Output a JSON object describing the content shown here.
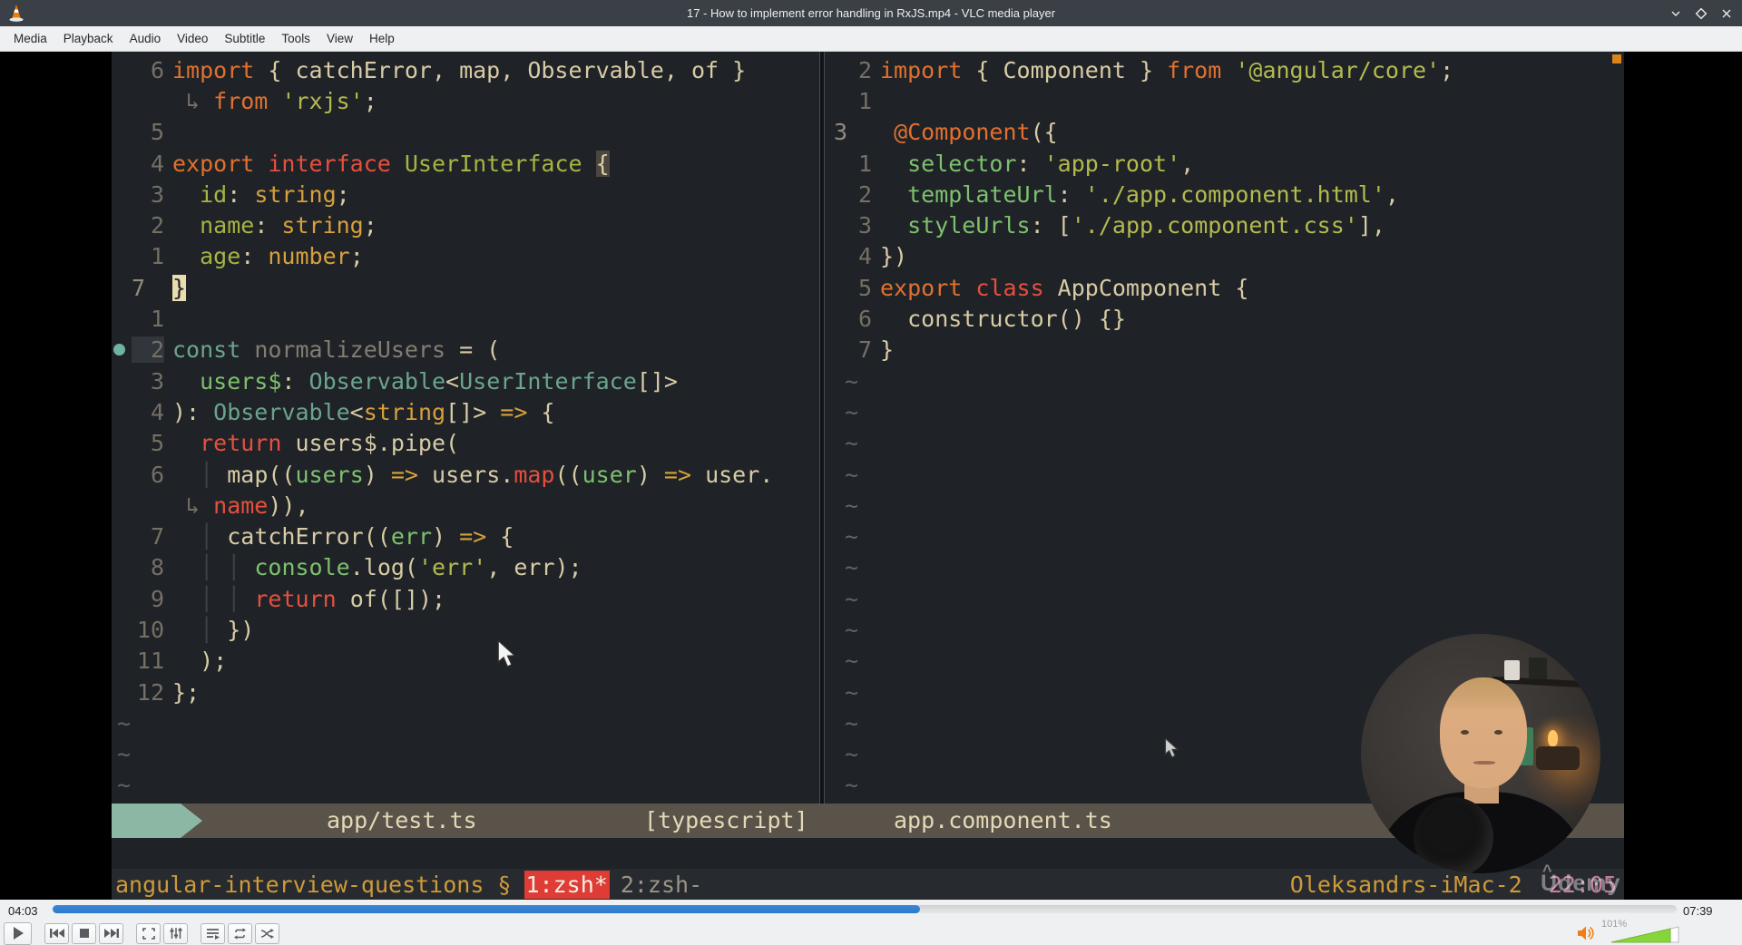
{
  "window": {
    "title": "17 - How to implement error handling in RxJS.mp4 - VLC media player",
    "menu": [
      "Media",
      "Playback",
      "Audio",
      "Video",
      "Subtitle",
      "Tools",
      "View",
      "Help"
    ]
  },
  "colors": {
    "editor_bg": "#1f2327",
    "statusline_bg": "#59534a",
    "statusline_accent": "#8cb7a5",
    "tmux_bg": "#272b30",
    "tmux_active_window_bg": "#de3c35",
    "seek_fill": "#3b87d8",
    "volume_fill": "#86d53b",
    "syntax_orange": "#e1702e",
    "syntax_red": "#e64f3e",
    "syntax_yellow": "#d8a03c",
    "syntax_lime": "#a7b343",
    "syntax_teal": "#6ba48d",
    "syntax_green": "#7dc16e"
  },
  "editor": {
    "left_pane": {
      "status_file": "app/test.ts",
      "status_type": "[typescript]",
      "tildes": 3,
      "rows": [
        {
          "n": "6",
          "s": [
            [
              "import ",
              "o"
            ],
            [
              "{ catchError, map, Observable, of }",
              "fg"
            ]
          ]
        },
        {
          "n": "",
          "s": [
            [
              " ↳ ",
              "wrap"
            ],
            [
              "from ",
              "o"
            ],
            [
              "'rxjs'",
              "str"
            ],
            [
              ";",
              "fg"
            ]
          ]
        },
        {
          "n": "5",
          "s": []
        },
        {
          "n": "4",
          "s": [
            [
              "export ",
              "o"
            ],
            [
              "interface ",
              "r"
            ],
            [
              "UserInterface ",
              "lime"
            ],
            [
              "{",
              "mp"
            ]
          ]
        },
        {
          "n": "3",
          "s": [
            [
              "  id",
              "lime"
            ],
            [
              ": ",
              "fg"
            ],
            [
              "string",
              "y"
            ],
            [
              ";",
              "fg"
            ]
          ]
        },
        {
          "n": "2",
          "s": [
            [
              "  name",
              "lime"
            ],
            [
              ": ",
              "fg"
            ],
            [
              "string",
              "y"
            ],
            [
              ";",
              "fg"
            ]
          ]
        },
        {
          "n": "1",
          "s": [
            [
              "  age",
              "lime"
            ],
            [
              ": ",
              "fg"
            ],
            [
              "number",
              "y"
            ],
            [
              ";",
              "fg"
            ]
          ]
        },
        {
          "n": "7",
          "cur": true,
          "s": [
            [
              "}",
              "cursor"
            ]
          ]
        },
        {
          "n": "1",
          "s": []
        },
        {
          "n": "2",
          "sign": true,
          "numhl": true,
          "s": [
            [
              "const ",
              "teal"
            ],
            [
              "normalizeUsers ",
              "dim"
            ],
            [
              "= (",
              "fg"
            ]
          ]
        },
        {
          "n": "3",
          "s": [
            [
              "  users$",
              "green"
            ],
            [
              ": ",
              "fg"
            ],
            [
              "Observable",
              "teal"
            ],
            [
              "<",
              "fg"
            ],
            [
              "UserInterface",
              "teal"
            ],
            [
              "[]>",
              "fg"
            ]
          ]
        },
        {
          "n": "4",
          "s": [
            [
              "): ",
              "fg"
            ],
            [
              "Observable",
              "teal"
            ],
            [
              "<",
              "fg"
            ],
            [
              "string",
              "y"
            ],
            [
              "[]> ",
              "fg"
            ],
            [
              "=> ",
              "y"
            ],
            [
              "{",
              "fg"
            ]
          ]
        },
        {
          "n": "5",
          "s": [
            [
              "  return ",
              "r"
            ],
            [
              "users$.pipe(",
              "fg"
            ]
          ]
        },
        {
          "n": "6",
          "s": [
            [
              "  ",
              "fg"
            ],
            [
              "│",
              "guide"
            ],
            [
              " map((",
              "fg"
            ],
            [
              "users",
              "green"
            ],
            [
              ") ",
              "fg"
            ],
            [
              "=> ",
              "y"
            ],
            [
              "users.",
              "fg"
            ],
            [
              "map",
              "r"
            ],
            [
              "((",
              "fg"
            ],
            [
              "user",
              "green"
            ],
            [
              ") ",
              "fg"
            ],
            [
              "=> ",
              "y"
            ],
            [
              "user.",
              "fg"
            ]
          ]
        },
        {
          "n": "",
          "s": [
            [
              " ↳ ",
              "wrap"
            ],
            [
              "name",
              "r"
            ],
            [
              ")),",
              "fg"
            ]
          ]
        },
        {
          "n": "7",
          "s": [
            [
              "  ",
              "fg"
            ],
            [
              "│",
              "guide"
            ],
            [
              " catchError((",
              "fg"
            ],
            [
              "err",
              "green"
            ],
            [
              ") ",
              "fg"
            ],
            [
              "=> ",
              "y"
            ],
            [
              "{",
              "fg"
            ]
          ]
        },
        {
          "n": "8",
          "s": [
            [
              "  ",
              "fg"
            ],
            [
              "│",
              "guide"
            ],
            [
              " ",
              "fg"
            ],
            [
              "│",
              "guide"
            ],
            [
              " console",
              "green"
            ],
            [
              ".log(",
              "fg"
            ],
            [
              "'err'",
              "str"
            ],
            [
              ", err);",
              "fg"
            ]
          ]
        },
        {
          "n": "9",
          "s": [
            [
              "  ",
              "fg"
            ],
            [
              "│",
              "guide"
            ],
            [
              " ",
              "fg"
            ],
            [
              "│",
              "guide"
            ],
            [
              " ",
              "fg"
            ],
            [
              "return ",
              "r"
            ],
            [
              "of([]);",
              "fg"
            ]
          ]
        },
        {
          "n": "10",
          "s": [
            [
              "  ",
              "fg"
            ],
            [
              "│",
              "guide"
            ],
            [
              " })",
              "fg"
            ]
          ]
        },
        {
          "n": "11",
          "s": [
            [
              "  );",
              "fg"
            ]
          ]
        },
        {
          "n": "12",
          "s": [
            [
              "};",
              "fg"
            ]
          ]
        }
      ]
    },
    "right_pane": {
      "status_file": "app.component.ts",
      "tildes": 14,
      "rows": [
        {
          "n": "2",
          "s": [
            [
              "import ",
              "o"
            ],
            [
              "{ Component } ",
              "fg"
            ],
            [
              "from ",
              "o"
            ],
            [
              "'@angular/core'",
              "str"
            ],
            [
              ";",
              "fg"
            ]
          ]
        },
        {
          "n": "1",
          "s": []
        },
        {
          "n": "3",
          "cur": true,
          "s": [
            [
              " ",
              "fg"
            ],
            [
              "@Component",
              "o"
            ],
            [
              "({",
              "fg"
            ]
          ]
        },
        {
          "n": "1",
          "s": [
            [
              "  selector",
              "green"
            ],
            [
              ": ",
              "fg"
            ],
            [
              "'app-root'",
              "str"
            ],
            [
              ",",
              "fg"
            ]
          ]
        },
        {
          "n": "2",
          "s": [
            [
              "  templateUrl",
              "green"
            ],
            [
              ": ",
              "fg"
            ],
            [
              "'./app.component.html'",
              "str"
            ],
            [
              ",",
              "fg"
            ]
          ]
        },
        {
          "n": "3",
          "s": [
            [
              "  styleUrls",
              "green"
            ],
            [
              ": [",
              "fg"
            ],
            [
              "'./app.component.css'",
              "str"
            ],
            [
              "],",
              "fg"
            ]
          ]
        },
        {
          "n": "4",
          "s": [
            [
              "})",
              "fg"
            ]
          ]
        },
        {
          "n": "5",
          "s": [
            [
              "export ",
              "o"
            ],
            [
              "class ",
              "r"
            ],
            [
              "AppComponent ",
              "fg"
            ],
            [
              "{",
              "fg"
            ]
          ]
        },
        {
          "n": "6",
          "s": [
            [
              "  constructor() {}",
              "fg"
            ]
          ]
        },
        {
          "n": "7",
          "s": [
            [
              "}",
              "fg"
            ]
          ]
        }
      ]
    },
    "tmux": {
      "session": "angular-interview-questions §",
      "window_active": "1:zsh*",
      "window_last": "2:zsh-",
      "host": "Oleksandrs-iMac-2",
      "clock": "22:05"
    },
    "watermark": "Udemy"
  },
  "vlc": {
    "elapsed": "04:03",
    "total": "07:39",
    "progress": 0.534,
    "volume_label": "101%",
    "volume_fraction": 0.88
  }
}
